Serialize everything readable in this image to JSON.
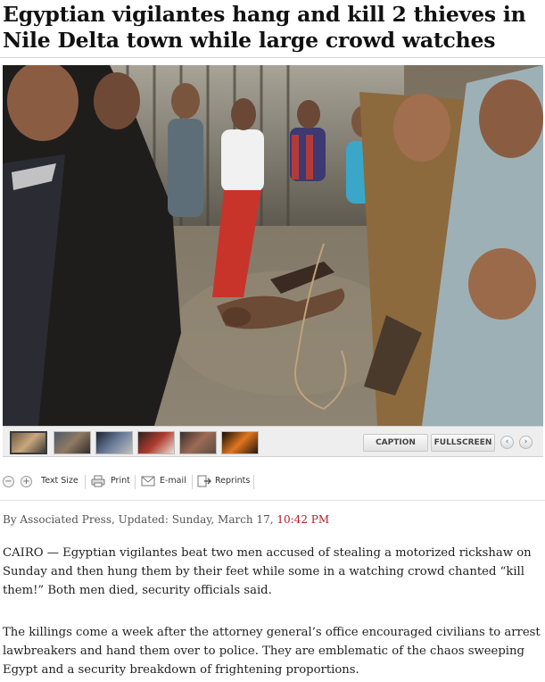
{
  "article": {
    "headline": "Egyptian vigilantes hang and kill 2 thieves in Nile Delta town while large crowd watches",
    "byline": {
      "prefix": "By Associated Press, Updated: Sunday, March 17, ",
      "time": "10:42 PM"
    },
    "paragraphs": [
      "CAIRO — Egyptian vigilantes beat two men accused of stealing a motorized rickshaw on Sunday and then hung them by their feet while some in a watching crowd chanted “kill them!” Both men died, security officials said.",
      "The killings come a week after the attorney general’s office encouraged civilians to arrest lawbreakers and hand them over to police. They are emblematic of the chaos sweeping Egypt and a security breakdown of frightening proportions."
    ]
  },
  "gallery": {
    "caption_button": "CAPTION",
    "fullscreen_button": "FULLSCREEN",
    "prev_icon": "chevron-left-icon",
    "next_icon": "chevron-right-icon",
    "thumbnail_count": 6,
    "active_index": 0
  },
  "tools": {
    "decrease_icon": "minus-icon",
    "increase_icon": "plus-icon",
    "text_size_label": "Text Size",
    "print_label": "Print",
    "email_label": "E-mail",
    "reprints_label": "Reprints"
  },
  "colors": {
    "timestamp": "#b3202a",
    "nav_arrow": "#3a6fb0"
  }
}
